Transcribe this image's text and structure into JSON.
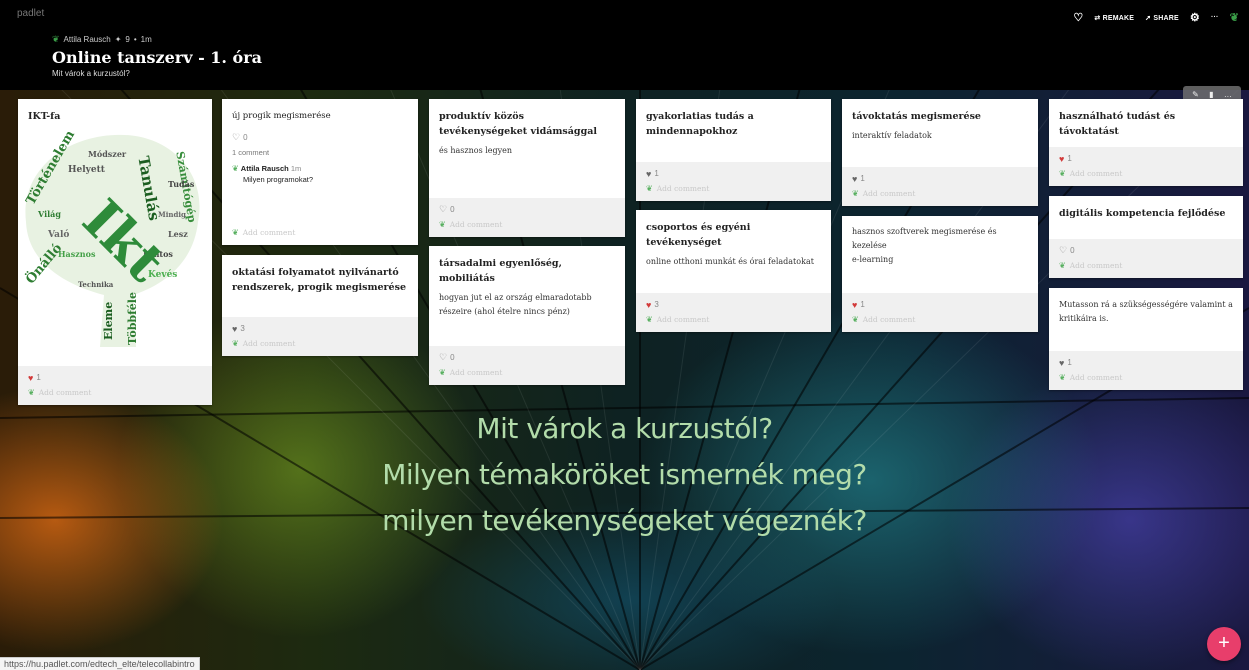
{
  "app": {
    "brand": "padlet"
  },
  "header": {
    "author": "Attila Rausch",
    "stat_glyph": "✦",
    "count": "9",
    "sep": "•",
    "age": "1m",
    "title": "Online tanszerv - 1. óra",
    "subtitle": "Mit várok a kurzustól?",
    "remake_label": "REMAKE",
    "share_label": "SHARE",
    "more_glyph": "···"
  },
  "add_comment_label": "Add comment",
  "cards": {
    "ikt": {
      "title": "IKT-fa",
      "likes": "1"
    },
    "uj": {
      "title": "új progik megismerése",
      "likes": "0",
      "comments_count": "1 comment",
      "comment": {
        "author": "Attila Rausch",
        "time": "1m",
        "text": "Milyen programokat?"
      }
    },
    "oktatasi": {
      "title": "oktatási folyamatot nyilvánartó rendszerek, progik megismerése",
      "likes": "3"
    },
    "produktiv": {
      "title": "produktív közös tevékenységeket vidámsággal",
      "body": "és hasznos legyen",
      "likes": "0"
    },
    "tarsadalmi": {
      "title": "társadalmi egyenlőség, mobiliátás",
      "body": "hogyan jut el az ország elmaradotabb részeire (ahol ételre nincs pénz)",
      "likes": "0"
    },
    "gyakorlatias": {
      "title": "gyakorlatias tudás a mindennapokhoz",
      "likes": "1"
    },
    "csoportos": {
      "title": "csoportos és egyéni tevékenységet",
      "body": "online otthoni munkát és órai feladatokat",
      "likes": "3"
    },
    "tavoktatas": {
      "title": "távoktatás megismerése",
      "body": "interaktív feladatok",
      "likes": "1"
    },
    "hasznos": {
      "body1": "hasznos szoftverek megismerése és kezelése",
      "body2": "e-learning",
      "likes": "1"
    },
    "hasznalhato": {
      "title": "használható tudást és távoktatást",
      "likes": "1"
    },
    "digitalis": {
      "title": "digitális kompetencia fejlődése",
      "likes": "0"
    },
    "mutasson": {
      "body": "Mutasson rá a szükségességére valamint a kritikáira is.",
      "likes": "1"
    }
  },
  "wordcloud": {
    "main": "Ikt",
    "words": [
      "Történelem",
      "Tanulás",
      "Számítógép",
      "Önálló",
      "Eleme",
      "Többféle",
      "Helyett",
      "Lesz",
      "Kevés",
      "Való",
      "Fontos",
      "Módszer",
      "Hasznos",
      "Mindig",
      "Technika",
      "Világ",
      "Tudás"
    ]
  },
  "overlay": {
    "line1": "Mit várok a kurzustól?",
    "line2": "Milyen témaköröket ismernék meg?",
    "line3": "milyen tevékenységeket végeznék?"
  },
  "status_url": "https://hu.padlet.com/edtech_elte/telecollabintro",
  "colors": {
    "accent": "#e83e6b",
    "leaf": "#3a9e48",
    "heart": "#d23a3a"
  }
}
